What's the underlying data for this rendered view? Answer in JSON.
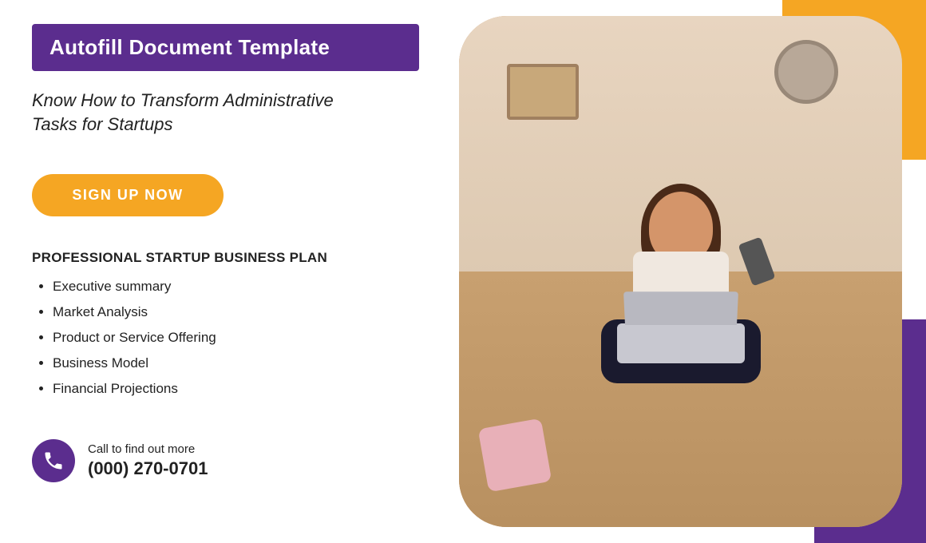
{
  "header": {
    "bar_title": "Autofill Document Template",
    "subtitle_line1": "Know How to Transform Administrative",
    "subtitle_line2": "Tasks for Startups"
  },
  "cta": {
    "signup_label": "SIGN UP NOW"
  },
  "business_plan": {
    "section_title": "PROFESSIONAL STARTUP BUSINESS PLAN",
    "items": [
      {
        "label": "Executive summary"
      },
      {
        "label": "Market Analysis"
      },
      {
        "label": "Product or Service Offering"
      },
      {
        "label": "Business Model"
      },
      {
        "label": "Financial Projections"
      }
    ]
  },
  "contact": {
    "call_label": "Call to find out more",
    "phone": "(000) 270-0701"
  },
  "colors": {
    "purple": "#5b2d8e",
    "orange": "#f5a623",
    "white": "#ffffff",
    "dark": "#222222"
  },
  "icons": {
    "phone": "☎"
  }
}
